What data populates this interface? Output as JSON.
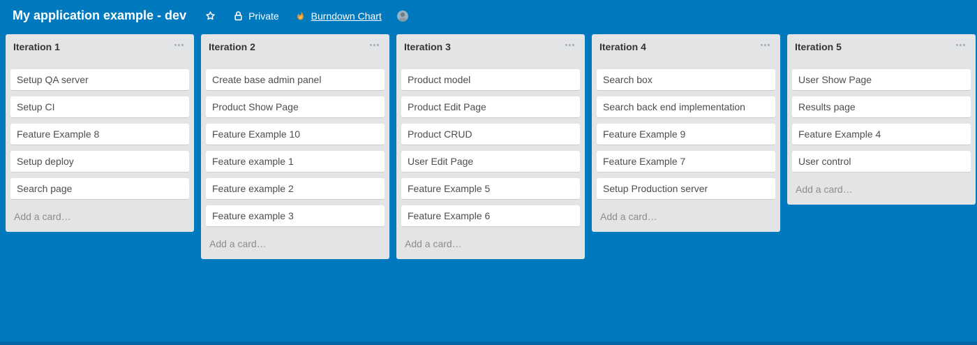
{
  "header": {
    "title": "My application example - dev",
    "privacy_label": "Private",
    "powerup_label": "Burndown Chart"
  },
  "icons": {
    "star": "star-outline",
    "lock": "padlock",
    "flame": "burndown-flame",
    "avatar": "member-silhouette",
    "list_menu": "ellipsis-three-dots"
  },
  "colors": {
    "board_bg": "#0079BF",
    "header_text": "#FFFFFF",
    "list_bg": "#E2E4E6",
    "list_title_text": "#333333",
    "card_bg": "#FFFFFF",
    "card_border": "#CCCCCC",
    "card_text": "#4D4D4D",
    "muted_text": "#8C8C8C",
    "flame_orange": "#E8912D",
    "flame_core": "#F8C96A"
  },
  "lists": [
    {
      "title": "Iteration 1",
      "cards": [
        "Setup QA server",
        "Setup CI",
        "Feature Example 8",
        "Setup deploy",
        "Search page"
      ],
      "add_card": "Add a card…"
    },
    {
      "title": "Iteration 2",
      "cards": [
        "Create base admin panel",
        "Product Show Page",
        "Feature Example 10",
        "Feature example 1",
        "Feature example 2",
        "Feature example 3"
      ],
      "add_card": "Add a card…"
    },
    {
      "title": "Iteration 3",
      "cards": [
        "Product model",
        "Product Edit Page",
        "Product CRUD",
        "User Edit Page",
        "Feature Example 5",
        "Feature Example 6"
      ],
      "add_card": "Add a card…"
    },
    {
      "title": "Iteration 4",
      "cards": [
        "Search box",
        "Search back end implementation",
        "Feature Example 9",
        "Feature Example 7",
        "Setup Production server"
      ],
      "add_card": "Add a card…"
    },
    {
      "title": "Iteration 5",
      "cards": [
        "User Show Page",
        "Results page",
        "Feature Example 4",
        "User control"
      ],
      "add_card": "Add a card…"
    }
  ]
}
